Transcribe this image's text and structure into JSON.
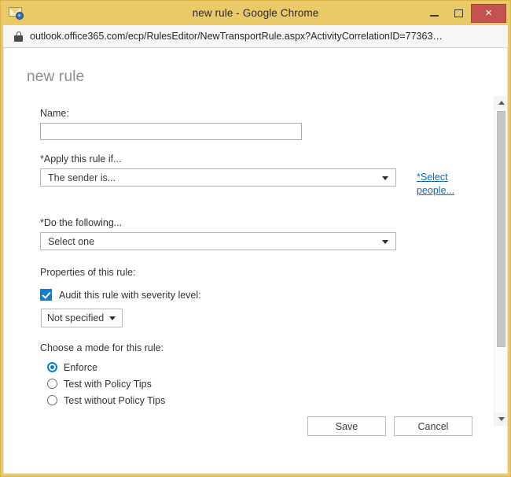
{
  "window": {
    "title": "new rule - Google Chrome",
    "app_icon": "mail-rule-icon",
    "controls": {
      "minimize_label": "–",
      "maximize_label": "□",
      "close_label": "×"
    }
  },
  "addressbar": {
    "lock_icon": "lock-icon",
    "url": "outlook.office365.com/ecp/RulesEditor/NewTransportRule.aspx?ActivityCorrelationID=77363…"
  },
  "page": {
    "heading": "new rule",
    "name": {
      "label": "Name:",
      "value": "",
      "placeholder": ""
    },
    "apply_rule": {
      "label": "*Apply this rule if...",
      "selected": "The sender is...",
      "link": "*Select people..."
    },
    "do_following": {
      "label": "*Do the following...",
      "selected": "Select one"
    },
    "properties": {
      "label": "Properties of this rule:",
      "audit": {
        "checked": true,
        "label": "Audit this rule with severity level:",
        "severity_selected": "Not specified"
      }
    },
    "mode": {
      "label": "Choose a mode for this rule:",
      "options": [
        {
          "label": "Enforce",
          "selected": true
        },
        {
          "label": "Test with Policy Tips",
          "selected": false
        },
        {
          "label": "Test without Policy Tips",
          "selected": false
        }
      ]
    },
    "actions": {
      "save": "Save",
      "cancel": "Cancel"
    }
  },
  "colors": {
    "window_chrome": "#eac968",
    "close_button": "#c4534f",
    "accent_blue": "#0a7fd4",
    "link_blue": "#1667b3",
    "heading_gray": "#8c8c8c"
  }
}
